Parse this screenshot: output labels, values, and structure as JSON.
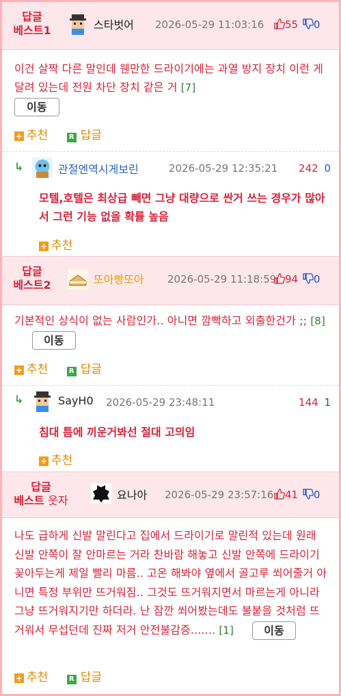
{
  "colors": {
    "accent": "#d6233a",
    "header_bg": "#fde7ea",
    "outer": "#ffb3b8"
  },
  "comments": [
    {
      "tag_line1": "답글",
      "tag_line2": "베스트1",
      "nick": "스타벗어",
      "avatar_icon": "pixel-avatar-icon",
      "time": "2026-05-29 11:03:16",
      "up": "55",
      "down": "0",
      "body": "이건 살짝 다른 말인데 웬만한 드라이기에는 과열 방지 장치 이런 게 달려 있는데 전원 차단 장치 같은 거",
      "reply_count": "[7]",
      "move_label": "이동",
      "recommend_label": "추천",
      "reply_label": "답글",
      "reply": {
        "nick": "관절엔역시게보린",
        "avatar_icon": "squirtle-avatar-icon",
        "time": "2026-05-29 12:35:21",
        "up": "242",
        "down": "0",
        "body": "모텔,호텔은 최상급 빼면 그냥 대량으로 싼거 쓰는 경우가 많아서 그런 기능 없을 확률 높음",
        "recommend_label": "추천"
      }
    },
    {
      "tag_line1": "답글",
      "tag_line2": "베스트2",
      "nick": "또아빵또아",
      "avatar_icon": "bread-avatar-icon",
      "time": "2026-05-29 11:18:59",
      "up": "94",
      "down": "0",
      "body": "기본적인 상식이 없는 사람인가.. 아니면 깜빡하고 외출한건가 ;;",
      "reply_count": "[8]",
      "move_label": "이동",
      "recommend_label": "추천",
      "reply_label": "답글",
      "reply": {
        "nick": "SayH0",
        "avatar_icon": "pixel-avatar-icon",
        "time": "2026-05-29 23:48:11",
        "up": "144",
        "down": "1",
        "body": "침대 틈에 끼운거봐선 절대 고의임",
        "recommend_label": "추천"
      }
    },
    {
      "tag_line1": "답글",
      "tag_line2a": "베스트",
      "tag_line2b": "웃자",
      "nick": "요나아",
      "avatar_icon": "ink-splat-avatar-icon",
      "time": "2026-05-29 23:57:16",
      "up": "41",
      "down": "0",
      "body": "나도 급하게 신발 말린다고 집에서 드라이기로 말린적 있는데 원래 신발 안쪽이 잘 안마르는 거라 찬바람 해놓고 신발 안쪽에 드라이기 꽂아두는게 제일 빨리 마름.. 고온 해봐야 옆에서 골고루 쐬어줄거 아니면 특정 부위만 뜨거워짐.. 그것도 뜨거워지면서 마르는게 아니라 그냥 뜨거워지기만 하더라. 난 잠깐 쐬어봤는데도 불붙을 것처럼 뜨거워서 무섭던데 진짜 저거 안전불감증.......",
      "reply_count": "[1]",
      "move_label": "이동",
      "recommend_label": "추천",
      "reply_label": "답글"
    }
  ]
}
